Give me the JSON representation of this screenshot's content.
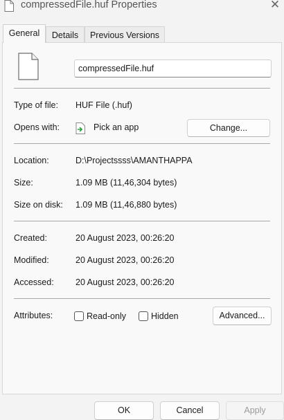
{
  "window": {
    "title": "compressedFile.huf Properties"
  },
  "tabs": [
    {
      "label": "General",
      "active": true
    },
    {
      "label": "Details",
      "active": false
    },
    {
      "label": "Previous Versions",
      "active": false
    }
  ],
  "file": {
    "name": "compressedFile.huf"
  },
  "type_of_file": {
    "label": "Type of file:",
    "value": "HUF File (.huf)"
  },
  "opens_with": {
    "label": "Opens with:",
    "value": "Pick an app",
    "change_button": "Change..."
  },
  "location": {
    "label": "Location:",
    "value": "D:\\Projectssss\\AMANTHAPPA"
  },
  "size": {
    "label": "Size:",
    "value": "1.09 MB (11,46,304 bytes)"
  },
  "size_on_disk": {
    "label": "Size on disk:",
    "value": "1.09 MB (11,46,880 bytes)"
  },
  "created": {
    "label": "Created:",
    "value": "20 August 2023, 00:26:20"
  },
  "modified": {
    "label": "Modified:",
    "value": "20 August 2023, 00:26:20"
  },
  "accessed": {
    "label": "Accessed:",
    "value": "20 August 2023, 00:26:20"
  },
  "attributes": {
    "label": "Attributes:",
    "read_only": {
      "label": "Read-only",
      "checked": false
    },
    "hidden": {
      "label": "Hidden",
      "checked": false
    },
    "advanced_button": "Advanced..."
  },
  "footer": {
    "ok": "OK",
    "cancel": "Cancel",
    "apply": "Apply"
  },
  "icons": {
    "title": "document-icon",
    "close": "close-icon",
    "file": "blank-document-icon",
    "app": "pick-app-icon"
  },
  "colors": {
    "accent_green": "#2e9e3e",
    "apply_disabled_text": "#9a9a9a"
  }
}
